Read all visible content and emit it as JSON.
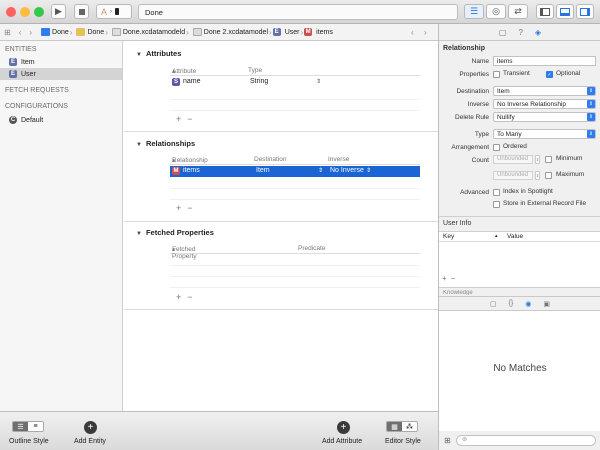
{
  "toolbar": {
    "status": "Done",
    "colors": {
      "close": "#fc615d",
      "minimize": "#fdbc40",
      "zoom": "#34c84a"
    }
  },
  "jumpbar": {
    "crumbs": [
      "Done",
      "Done",
      "Done.xcdatamodeld",
      "Done 2.xcdatamodel",
      "User",
      "items"
    ]
  },
  "sidebar": {
    "entities_header": "ENTITIES",
    "entities": [
      {
        "name": "Item",
        "icon": "entity-icon"
      },
      {
        "name": "User",
        "icon": "entity-icon",
        "selected": true
      }
    ],
    "fetch_requests_header": "FETCH REQUESTS",
    "configurations_header": "CONFIGURATIONS",
    "configurations": [
      {
        "name": "Default",
        "icon": "configuration-icon"
      }
    ]
  },
  "attributes": {
    "title": "Attributes",
    "columns": [
      "Attribute",
      "Type"
    ],
    "rows": [
      {
        "name": "name",
        "type": "String"
      }
    ]
  },
  "relationships": {
    "title": "Relationships",
    "columns": [
      "Relationship",
      "Destination",
      "Inverse"
    ],
    "rows": [
      {
        "name": "items",
        "destination": "Item",
        "inverse": "No Inverse"
      }
    ]
  },
  "fetched_properties": {
    "title": "Fetched Properties",
    "columns": [
      "Fetched Property",
      "Predicate"
    ]
  },
  "bottom": {
    "outline_style": "Outline Style",
    "add_entity": "Add Entity",
    "add_attribute": "Add Attribute",
    "editor_style": "Editor Style"
  },
  "inspector": {
    "title": "Relationship",
    "name_label": "Name",
    "name_value": "items",
    "properties_label": "Properties",
    "transient_label": "Transient",
    "optional_label": "Optional",
    "destination_label": "Destination",
    "destination_value": "Item",
    "inverse_label": "Inverse",
    "inverse_value": "No Inverse Relationship",
    "delete_rule_label": "Delete Rule",
    "delete_rule_value": "Nullify",
    "type_label": "Type",
    "type_value": "To Many",
    "arrangement_label": "Arrangement",
    "ordered_label": "Ordered",
    "count_label": "Count",
    "unbounded": "Unbounded",
    "minimum_label": "Minimum",
    "maximum_label": "Maximum",
    "advanced_label": "Advanced",
    "index_label": "Index in Spotlight",
    "store_label": "Store in External Record File",
    "user_info_title": "User Info",
    "key_col": "Key",
    "value_col": "Value",
    "library_title": "Knowledge",
    "no_matches": "No Matches"
  }
}
